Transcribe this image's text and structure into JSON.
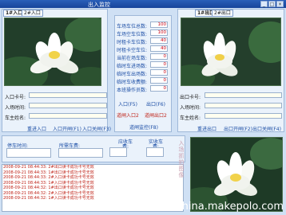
{
  "window": {
    "title": "出入监控"
  },
  "left_tabs": [
    "1#入口",
    "2#入口"
  ],
  "right_tabs": [
    "1#出口",
    "2#出口"
  ],
  "left_form": {
    "labels": [
      "入口卡号:",
      "入场时间:",
      "车主姓名:"
    ],
    "values": [
      "",
      "",
      ""
    ],
    "buttons": [
      "重进入口",
      "入口开闸(F1)",
      "入口关闸(F3)"
    ]
  },
  "right_form": {
    "labels": [
      "出口卡号:",
      "入场时间:",
      "车主姓名:"
    ],
    "values": [
      "",
      "",
      ""
    ],
    "buttons": [
      "重进出口",
      "出口开闸(F2)",
      "出口关闸(F4)"
    ]
  },
  "stats": [
    {
      "label": "车场车位总数:",
      "value": "100"
    },
    {
      "label": "车场空车位数:",
      "value": "100"
    },
    {
      "label": "时租卡车位数:",
      "value": "40"
    },
    {
      "label": "时租卡空车位:",
      "value": "40"
    },
    {
      "label": "当前在场车数:",
      "value": "0"
    },
    {
      "label": "临时车进场数:",
      "value": "0"
    },
    {
      "label": "临时车出场数:",
      "value": "0"
    },
    {
      "label": "临时车收费额:",
      "value": "0"
    },
    {
      "label": "本班操作员数:",
      "value": "0"
    }
  ],
  "center_links": [
    "入口(F5)",
    "出口(F6)",
    "道闸入口2",
    "道闸出口2",
    "道闸监控(F8)"
  ],
  "bottom": {
    "time_label": "停车时间:",
    "fee_label": "所需车费:",
    "receivable_label": "应收车费:",
    "paid_label": "实收车费:",
    "vertical_text": "入场抓拍图像"
  },
  "log": [
    "2008-09-21 08:44:33: 2#出口读卡成功卡号无效",
    "2008-09-21 08:44:33: 1#出口读卡成功卡号无效",
    "2008-09-21 08:44:33: 2#入口读卡成功卡号无效",
    "2008-09-21 08:44:33: 1#入口读卡成功卡号无效",
    "2008-09-21 08:44:32: 1#出口读卡成功卡号无效",
    "2008-09-21 08:44:32: 2#入口读卡成功卡号无效",
    "2008-09-21 08:44:32: 1#入口读卡成功卡号无效"
  ],
  "watermark": "china.makepolo.com"
}
